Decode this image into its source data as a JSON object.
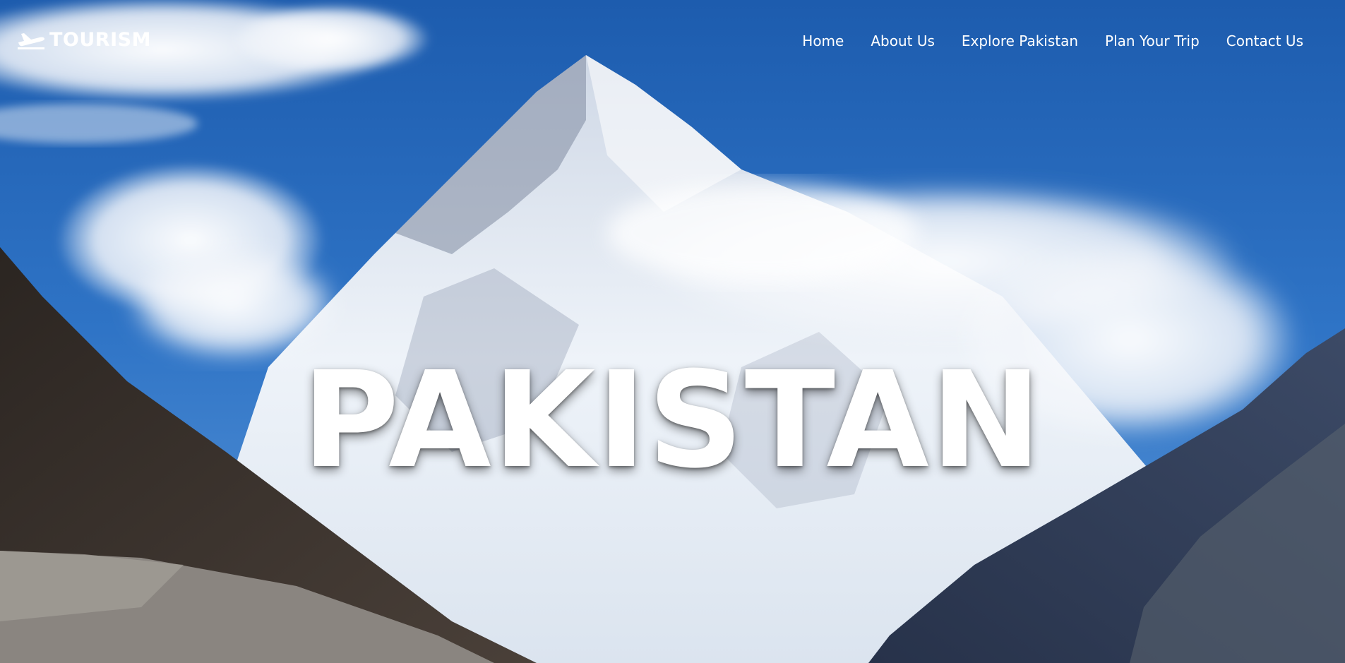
{
  "brand": {
    "name": "TOURISM",
    "icon": "airplane-icon"
  },
  "nav": {
    "items": [
      {
        "label": "Home"
      },
      {
        "label": "About Us"
      },
      {
        "label": "Explore Pakistan"
      },
      {
        "label": "Plan Your Trip"
      },
      {
        "label": "Contact Us"
      }
    ]
  },
  "hero": {
    "headline": "PAKISTAN",
    "background": "snow-capped-mountain-peak-photo"
  },
  "colors": {
    "sky": "#2a6fc2",
    "text": "#ffffff"
  }
}
